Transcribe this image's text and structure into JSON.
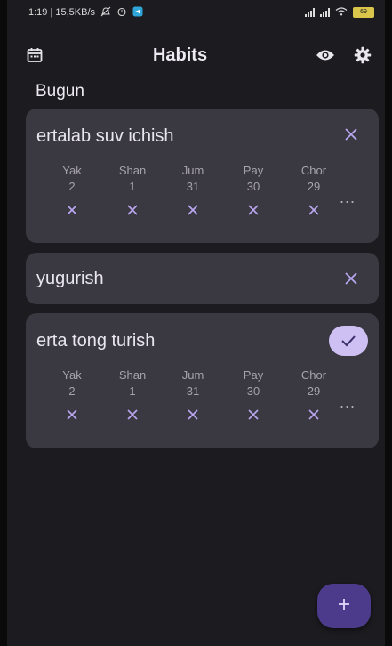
{
  "status_bar": {
    "left_text": "1:19 | 15,5KB/s",
    "battery": "69"
  },
  "app_bar": {
    "title": "Habits",
    "icons": [
      "calendar-icon",
      "eye-icon",
      "gear-icon"
    ]
  },
  "section_title": "Bugun",
  "habits": [
    {
      "name": "ertalab suv ichish",
      "completed_today": false,
      "days": [
        {
          "name": "Yak",
          "num": "2"
        },
        {
          "name": "Shan",
          "num": "1"
        },
        {
          "name": "Jum",
          "num": "31"
        },
        {
          "name": "Pay",
          "num": "30"
        },
        {
          "name": "Chor",
          "num": "29"
        }
      ]
    },
    {
      "name": "yugurish",
      "completed_today": false
    },
    {
      "name": "erta tong turish",
      "completed_today": true,
      "days": [
        {
          "name": "Yak",
          "num": "2"
        },
        {
          "name": "Shan",
          "num": "1"
        },
        {
          "name": "Jum",
          "num": "31"
        },
        {
          "name": "Pay",
          "num": "30"
        },
        {
          "name": "Chor",
          "num": "29"
        }
      ]
    }
  ],
  "more_label": "...",
  "colors": {
    "background": "#1c1b1f",
    "card": "#3a3840",
    "accent": "#cfc0f3",
    "mark": "#b8a6ef",
    "fab": "#4b3b8a"
  }
}
